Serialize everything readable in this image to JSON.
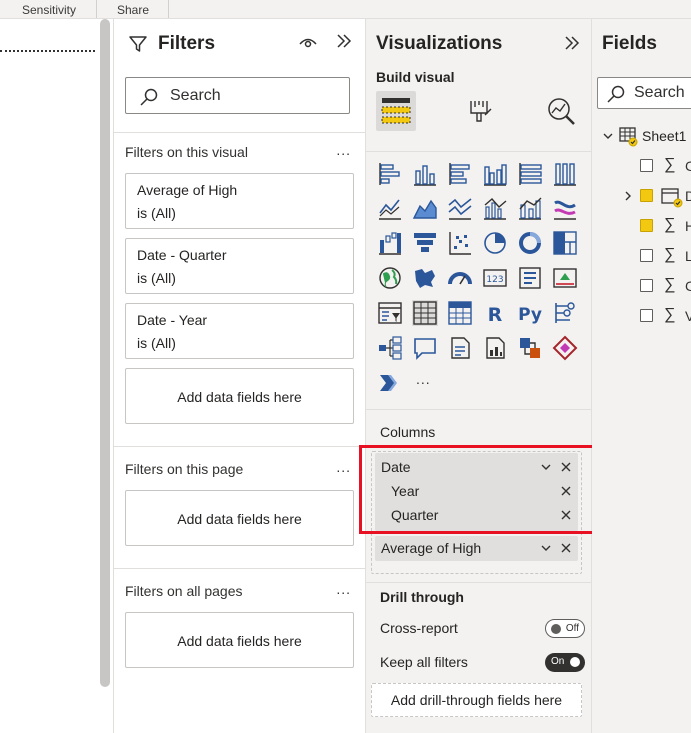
{
  "ribbon": {
    "tabs": [
      "Sensitivity",
      "Share"
    ]
  },
  "filters": {
    "title": "Filters",
    "search_placeholder": "Search",
    "sections": {
      "visual": "Filters on this visual",
      "page": "Filters on this page",
      "all": "Filters on all pages"
    },
    "more": "...",
    "cards": [
      {
        "name": "Average of High",
        "value": "is (All)"
      },
      {
        "name": "Date - Quarter",
        "value": "is (All)"
      },
      {
        "name": "Date - Year",
        "value": "is (All)"
      }
    ],
    "add_fields": "Add data fields here"
  },
  "visualizations": {
    "title": "Visualizations",
    "build_visual": "Build visual",
    "more_visuals": "...",
    "r_label": "R",
    "py_label": "Py",
    "num_label": "123",
    "columns_label": "Columns",
    "wells": {
      "date": "Date",
      "year": "Year",
      "quarter": "Quarter",
      "avg_high": "Average of High"
    },
    "drill_through": "Drill through",
    "cross_report": {
      "label": "Cross-report",
      "state": "Off"
    },
    "keep_all_filters": {
      "label": "Keep all filters",
      "state": "On"
    },
    "add_drill": "Add drill-through fields here"
  },
  "fields": {
    "title": "Fields",
    "search_placeholder": "Search",
    "table_name": "Sheet1",
    "items": [
      "C",
      "D",
      "H",
      "L",
      "C",
      "V"
    ]
  },
  "colors": {
    "accent_yellow": "#f2c811",
    "highlight_red": "#e81123",
    "icon_blue": "#2b579a",
    "pane_bg": "#f3f2f1"
  }
}
